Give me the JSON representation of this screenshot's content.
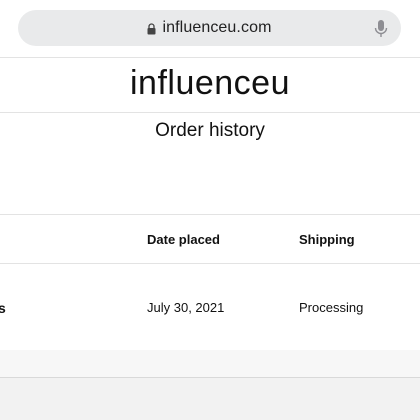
{
  "browser": {
    "url": "influenceu.com",
    "icons": {
      "lock": "lock-icon",
      "mic": "microphone-icon"
    }
  },
  "header": {
    "brand": "influenceu"
  },
  "main": {
    "title": "Order history",
    "table": {
      "columns": [
        "Date placed",
        "Shipping"
      ],
      "rows": [
        {
          "name_fragment": "s",
          "date": "July 30, 2021",
          "shipping": "Processing"
        }
      ]
    }
  },
  "colors": {
    "urlbar_bg": "#e9eaeb",
    "divider": "#e3e3e3",
    "text": "#111111"
  }
}
